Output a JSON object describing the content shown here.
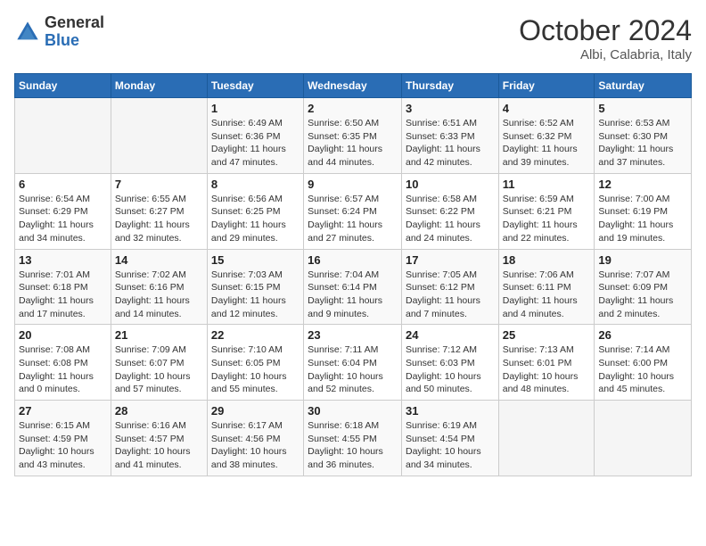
{
  "header": {
    "logo": {
      "general": "General",
      "blue": "Blue"
    },
    "title": "October 2024",
    "subtitle": "Albi, Calabria, Italy"
  },
  "weekdays": [
    "Sunday",
    "Monday",
    "Tuesday",
    "Wednesday",
    "Thursday",
    "Friday",
    "Saturday"
  ],
  "weeks": [
    [
      {
        "day": "",
        "info": ""
      },
      {
        "day": "",
        "info": ""
      },
      {
        "day": "1",
        "info": "Sunrise: 6:49 AM\nSunset: 6:36 PM\nDaylight: 11 hours and 47 minutes."
      },
      {
        "day": "2",
        "info": "Sunrise: 6:50 AM\nSunset: 6:35 PM\nDaylight: 11 hours and 44 minutes."
      },
      {
        "day": "3",
        "info": "Sunrise: 6:51 AM\nSunset: 6:33 PM\nDaylight: 11 hours and 42 minutes."
      },
      {
        "day": "4",
        "info": "Sunrise: 6:52 AM\nSunset: 6:32 PM\nDaylight: 11 hours and 39 minutes."
      },
      {
        "day": "5",
        "info": "Sunrise: 6:53 AM\nSunset: 6:30 PM\nDaylight: 11 hours and 37 minutes."
      }
    ],
    [
      {
        "day": "6",
        "info": "Sunrise: 6:54 AM\nSunset: 6:29 PM\nDaylight: 11 hours and 34 minutes."
      },
      {
        "day": "7",
        "info": "Sunrise: 6:55 AM\nSunset: 6:27 PM\nDaylight: 11 hours and 32 minutes."
      },
      {
        "day": "8",
        "info": "Sunrise: 6:56 AM\nSunset: 6:25 PM\nDaylight: 11 hours and 29 minutes."
      },
      {
        "day": "9",
        "info": "Sunrise: 6:57 AM\nSunset: 6:24 PM\nDaylight: 11 hours and 27 minutes."
      },
      {
        "day": "10",
        "info": "Sunrise: 6:58 AM\nSunset: 6:22 PM\nDaylight: 11 hours and 24 minutes."
      },
      {
        "day": "11",
        "info": "Sunrise: 6:59 AM\nSunset: 6:21 PM\nDaylight: 11 hours and 22 minutes."
      },
      {
        "day": "12",
        "info": "Sunrise: 7:00 AM\nSunset: 6:19 PM\nDaylight: 11 hours and 19 minutes."
      }
    ],
    [
      {
        "day": "13",
        "info": "Sunrise: 7:01 AM\nSunset: 6:18 PM\nDaylight: 11 hours and 17 minutes."
      },
      {
        "day": "14",
        "info": "Sunrise: 7:02 AM\nSunset: 6:16 PM\nDaylight: 11 hours and 14 minutes."
      },
      {
        "day": "15",
        "info": "Sunrise: 7:03 AM\nSunset: 6:15 PM\nDaylight: 11 hours and 12 minutes."
      },
      {
        "day": "16",
        "info": "Sunrise: 7:04 AM\nSunset: 6:14 PM\nDaylight: 11 hours and 9 minutes."
      },
      {
        "day": "17",
        "info": "Sunrise: 7:05 AM\nSunset: 6:12 PM\nDaylight: 11 hours and 7 minutes."
      },
      {
        "day": "18",
        "info": "Sunrise: 7:06 AM\nSunset: 6:11 PM\nDaylight: 11 hours and 4 minutes."
      },
      {
        "day": "19",
        "info": "Sunrise: 7:07 AM\nSunset: 6:09 PM\nDaylight: 11 hours and 2 minutes."
      }
    ],
    [
      {
        "day": "20",
        "info": "Sunrise: 7:08 AM\nSunset: 6:08 PM\nDaylight: 11 hours and 0 minutes."
      },
      {
        "day": "21",
        "info": "Sunrise: 7:09 AM\nSunset: 6:07 PM\nDaylight: 10 hours and 57 minutes."
      },
      {
        "day": "22",
        "info": "Sunrise: 7:10 AM\nSunset: 6:05 PM\nDaylight: 10 hours and 55 minutes."
      },
      {
        "day": "23",
        "info": "Sunrise: 7:11 AM\nSunset: 6:04 PM\nDaylight: 10 hours and 52 minutes."
      },
      {
        "day": "24",
        "info": "Sunrise: 7:12 AM\nSunset: 6:03 PM\nDaylight: 10 hours and 50 minutes."
      },
      {
        "day": "25",
        "info": "Sunrise: 7:13 AM\nSunset: 6:01 PM\nDaylight: 10 hours and 48 minutes."
      },
      {
        "day": "26",
        "info": "Sunrise: 7:14 AM\nSunset: 6:00 PM\nDaylight: 10 hours and 45 minutes."
      }
    ],
    [
      {
        "day": "27",
        "info": "Sunrise: 6:15 AM\nSunset: 4:59 PM\nDaylight: 10 hours and 43 minutes."
      },
      {
        "day": "28",
        "info": "Sunrise: 6:16 AM\nSunset: 4:57 PM\nDaylight: 10 hours and 41 minutes."
      },
      {
        "day": "29",
        "info": "Sunrise: 6:17 AM\nSunset: 4:56 PM\nDaylight: 10 hours and 38 minutes."
      },
      {
        "day": "30",
        "info": "Sunrise: 6:18 AM\nSunset: 4:55 PM\nDaylight: 10 hours and 36 minutes."
      },
      {
        "day": "31",
        "info": "Sunrise: 6:19 AM\nSunset: 4:54 PM\nDaylight: 10 hours and 34 minutes."
      },
      {
        "day": "",
        "info": ""
      },
      {
        "day": "",
        "info": ""
      }
    ]
  ]
}
